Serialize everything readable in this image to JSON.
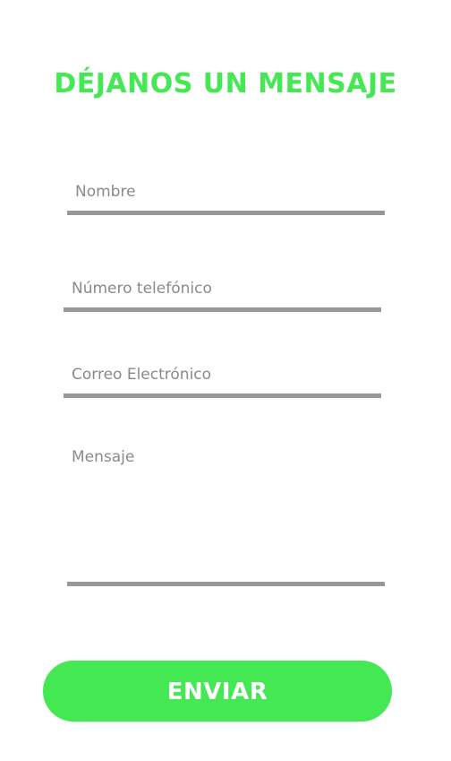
{
  "header": {
    "title": "DÉJANOS UN MENSAJE"
  },
  "form": {
    "name_placeholder": "Nombre",
    "phone_placeholder": "Número telefónico",
    "email_placeholder": "Correo Electrónico",
    "message_placeholder": "Mensaje",
    "submit_label": "ENVIAR"
  },
  "colors": {
    "accent": "#44e852",
    "underline": "#979797",
    "placeholder": "#8a8a8a",
    "background": "#ffffff"
  }
}
